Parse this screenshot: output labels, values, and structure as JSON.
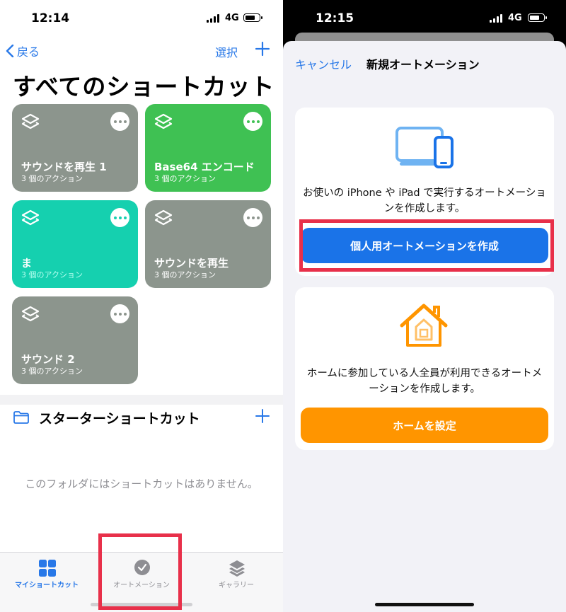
{
  "left_screen": {
    "status_bar": {
      "time": "12:14",
      "network": "4G"
    },
    "nav": {
      "back_label": "戻る",
      "select_label": "選択"
    },
    "title": "すべてのショートカット",
    "shortcuts": [
      {
        "name": "サウンドを再生 1",
        "subtitle": "3 個のアクション",
        "color": "#8c958d"
      },
      {
        "name": "Base64 エンコード",
        "subtitle": "3 個のアクション",
        "color": "#3fc153"
      },
      {
        "name": "ま",
        "subtitle": "3 個のアクション",
        "color": "#15d0af"
      },
      {
        "name": "サウンドを再生",
        "subtitle": "3 個のアクション",
        "color": "#8c958d"
      },
      {
        "name": "サウンド 2",
        "subtitle": "3 個のアクション",
        "color": "#8c958d"
      }
    ],
    "folder": {
      "title": "スターターショートカット",
      "empty_message": "このフォルダにはショートカットはありません。"
    },
    "tab_bar": {
      "tabs": [
        {
          "label": "マイショートカット",
          "icon": "grid-icon",
          "active": true
        },
        {
          "label": "オートメーション",
          "icon": "clock-check-icon",
          "active": false
        },
        {
          "label": "ギャラリー",
          "icon": "layers-icon",
          "active": false
        }
      ]
    }
  },
  "right_screen": {
    "status_bar": {
      "time": "12:15",
      "network": "4G"
    },
    "sheet": {
      "cancel_label": "キャンセル",
      "title": "新規オートメーション"
    },
    "personal_card": {
      "icon": "devices-icon",
      "description": "お使いの iPhone や iPad で実行するオートメーションを作成します。",
      "button_label": "個人用オートメーションを作成"
    },
    "home_card": {
      "icon": "home-icon",
      "description": "ホームに参加している人全員が利用できるオートメーションを作成します。",
      "button_label": "ホームを設定"
    }
  },
  "colors": {
    "accent_blue": "#2878e8",
    "button_blue": "#1a73e8",
    "button_orange": "#ff9500",
    "highlight_red": "#e8304a"
  }
}
